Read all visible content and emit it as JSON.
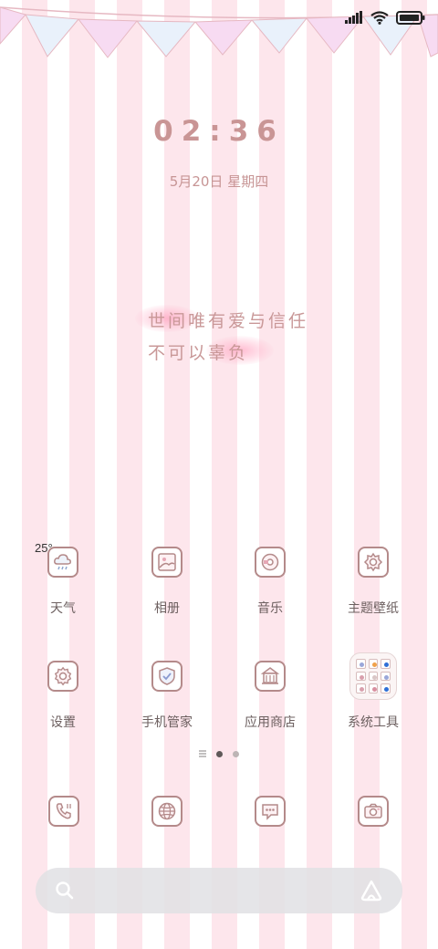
{
  "status_bar": {
    "icons": [
      "signal-icon",
      "wifi-icon",
      "battery-icon"
    ]
  },
  "lockscreen": {
    "time": "02:36",
    "date": "5月20日 星期四",
    "quote_line1": "世间唯有爱与信任",
    "quote_line2": "不可以辜负"
  },
  "weather": {
    "temperature": "25°"
  },
  "apps_row1": [
    {
      "label": "天气",
      "icon": "weather-icon"
    },
    {
      "label": "相册",
      "icon": "gallery-icon"
    },
    {
      "label": "音乐",
      "icon": "music-icon"
    },
    {
      "label": "主题壁纸",
      "icon": "theme-icon"
    }
  ],
  "apps_row2": [
    {
      "label": "设置",
      "icon": "settings-icon"
    },
    {
      "label": "手机管家",
      "icon": "shield-icon"
    },
    {
      "label": "应用商店",
      "icon": "store-icon"
    },
    {
      "label": "系统工具",
      "icon": "folder-icon"
    }
  ],
  "page_indicator": {
    "pages": 2,
    "current": 1
  },
  "dock": [
    {
      "icon": "phone-icon"
    },
    {
      "icon": "browser-icon"
    },
    {
      "icon": "messages-icon"
    },
    {
      "icon": "camera-icon"
    }
  ],
  "search_bar": {
    "left_icon": "search-icon",
    "right_icon": "assistant-icon"
  },
  "colors": {
    "stripe_pink": "#fde6ec",
    "icon_outline": "#b48a8a",
    "clock_text": "#c99595"
  }
}
